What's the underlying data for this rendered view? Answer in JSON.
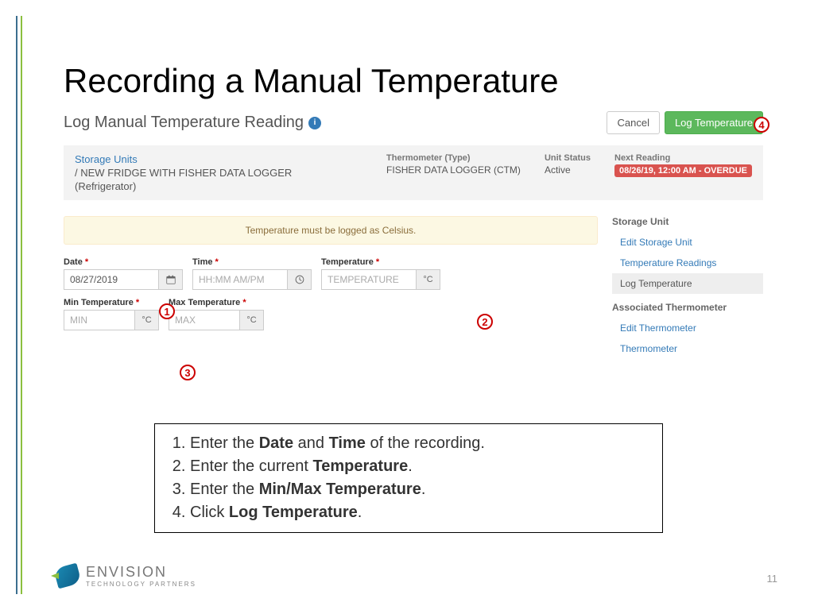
{
  "slide": {
    "title": "Recording a Manual Temperature",
    "page_number": "11"
  },
  "app": {
    "heading": "Log Manual Temperature Reading",
    "info_icon": "i",
    "actions": {
      "cancel": "Cancel",
      "log": "Log Temperature"
    },
    "breadcrumb": {
      "root": "Storage Units",
      "sep": "/",
      "unit_name": "NEW FRIDGE WITH FISHER DATA LOGGER",
      "unit_type": "(Refrigerator)"
    },
    "info_cols": {
      "thermo_label": "Thermometer (Type)",
      "thermo_value": "FISHER DATA LOGGER (CTM)",
      "status_label": "Unit Status",
      "status_value": "Active",
      "next_label": "Next Reading",
      "next_value": "08/26/19, 12:00 AM - OVERDUE"
    },
    "alert": "Temperature must be logged as Celsius.",
    "fields": {
      "date": {
        "label": "Date",
        "value": "08/27/2019",
        "addon_icon": "calendar"
      },
      "time": {
        "label": "Time",
        "placeholder": "HH:MM AM/PM",
        "addon_icon": "clock"
      },
      "temperature": {
        "label": "Temperature",
        "placeholder": "TEMPERATURE",
        "addon": "°C"
      },
      "min": {
        "label": "Min Temperature",
        "placeholder": "MIN",
        "addon": "°C"
      },
      "max": {
        "label": "Max Temperature",
        "placeholder": "MAX",
        "addon": "°C"
      }
    },
    "sidebar": {
      "hdr1": "Storage Unit",
      "link_edit_unit": "Edit Storage Unit",
      "link_readings": "Temperature Readings",
      "link_log_temp": "Log Temperature",
      "hdr2": "Associated Thermometer",
      "link_edit_thermo": "Edit Thermometer",
      "link_thermo": "Thermometer"
    }
  },
  "callouts": {
    "c1": "1",
    "c2": "2",
    "c3": "3",
    "c4": "4"
  },
  "steps": {
    "s1a": "Enter the ",
    "s1b": "Date",
    "s1c": " and ",
    "s1d": "Time",
    "s1e": " of the recording.",
    "s2a": "Enter the current ",
    "s2b": "Temperature",
    "s2c": ".",
    "s3a": "Enter the ",
    "s3b": "Min/Max Temperature",
    "s3c": ".",
    "s4a": "Click ",
    "s4b": "Log Temperature",
    "s4c": "."
  },
  "logo": {
    "name": "ENVISION",
    "sub": "TECHNOLOGY PARTNERS"
  }
}
